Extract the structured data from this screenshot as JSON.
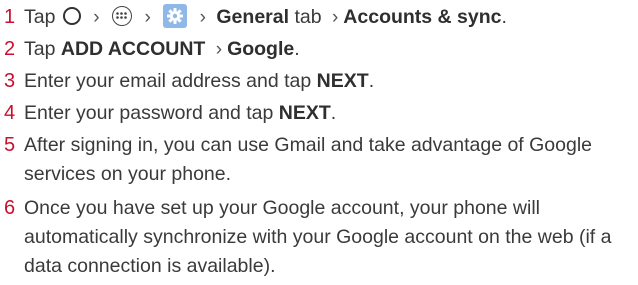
{
  "steps": [
    {
      "number": "1",
      "segments": {
        "tap": "Tap",
        "general": "General",
        "tab": "tab",
        "accounts": "Accounts & sync",
        "period": "."
      }
    },
    {
      "number": "2",
      "segments": {
        "tap": "Tap",
        "add_account": "ADD ACCOUNT",
        "google": "Google",
        "period": "."
      }
    },
    {
      "number": "3",
      "segments": {
        "pre": "Enter your email address and tap",
        "next": "NEXT",
        "period": "."
      }
    },
    {
      "number": "4",
      "segments": {
        "pre": "Enter your password and tap",
        "next": "NEXT",
        "period": "."
      }
    },
    {
      "number": "5",
      "lines": [
        "After signing in, you can use Gmail and take advantage of Google",
        "services on your phone."
      ]
    },
    {
      "number": "6",
      "lines": [
        "Once you have set up your Google account, your phone will",
        "automatically synchronize with your Google account on the web (if a",
        "data connection is available)."
      ]
    }
  ],
  "icons": {
    "home": "home-circle-icon",
    "apps": "apps-grid-icon",
    "settings": "settings-gear-icon",
    "separator": "chevron-right-icon"
  },
  "colors": {
    "step_number": "#c8102e",
    "body_text": "#3a3a3a",
    "settings_icon_bg": "#8fb8e8"
  }
}
